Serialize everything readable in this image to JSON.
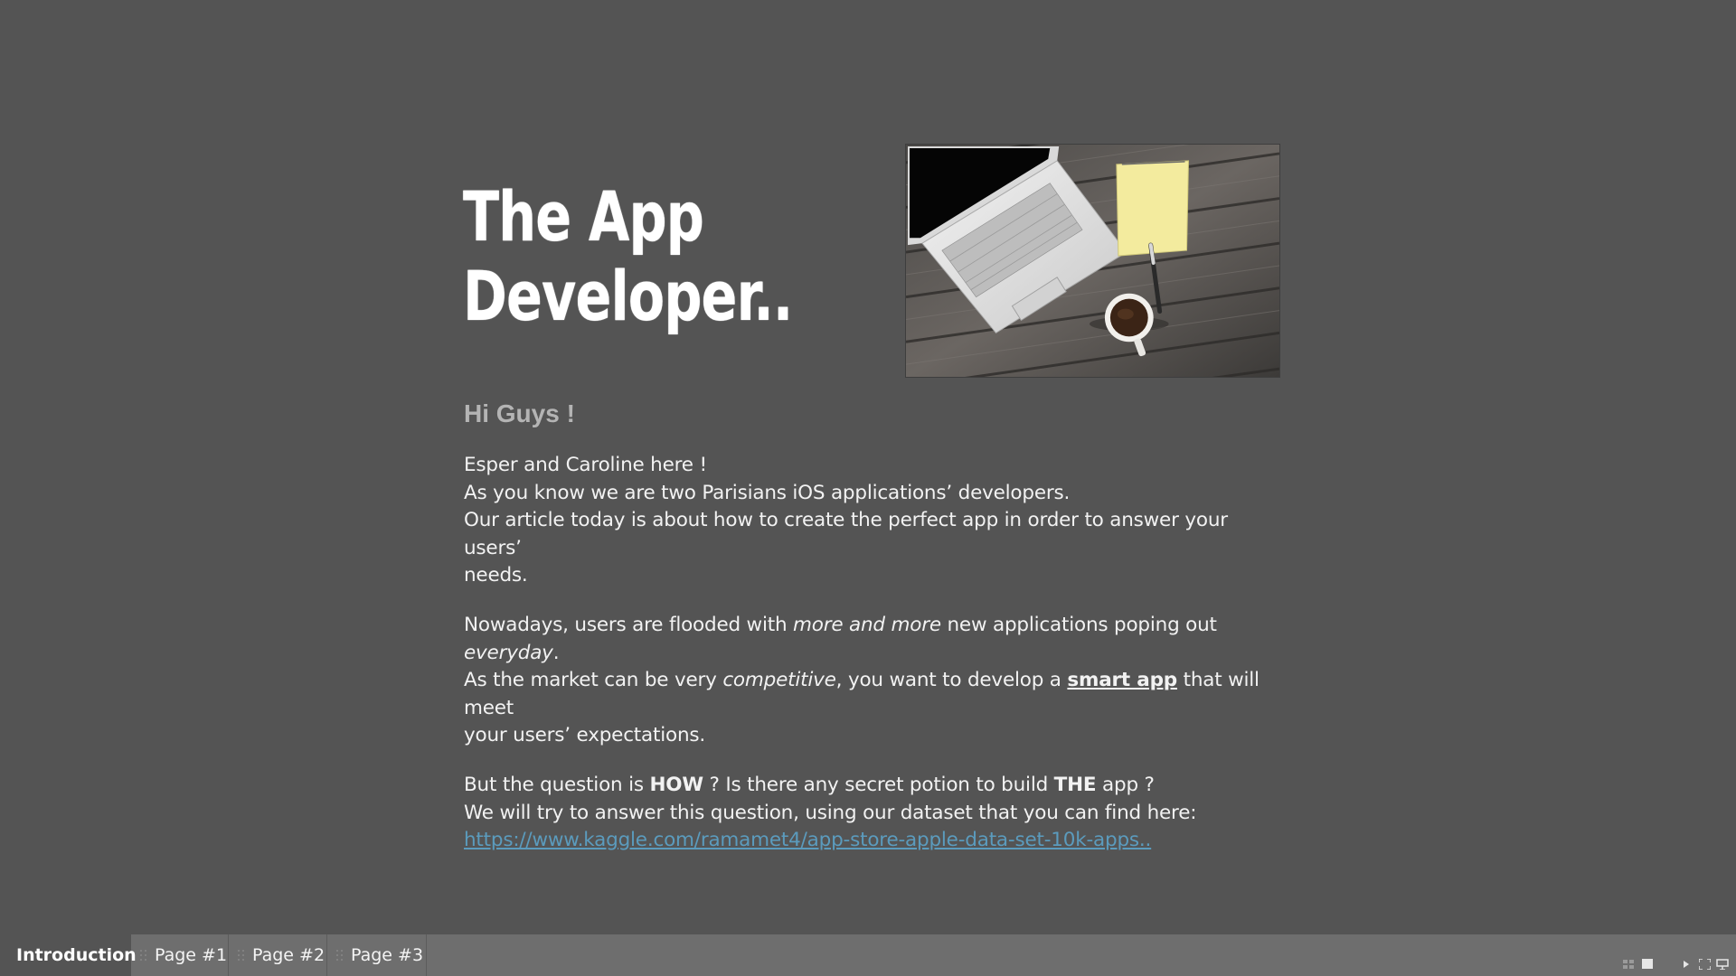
{
  "story": {
    "title_line1": "The App",
    "title_line2": "Developer..",
    "greeting": "Hi Guys !",
    "p1": {
      "line1": "Esper and Caroline here !",
      "line2": "As you know we are two Parisians iOS applications’ developers.",
      "line3a": "Our article today is about how to create the perfect app in order to answer your users’",
      "line3b": "needs."
    },
    "p2": {
      "a": "Nowadays, users are flooded with ",
      "a_em": "more and more",
      "a_rest": " new applications poping out",
      "b_em": "everyday",
      "b_rest": ".",
      "c": "As the market can be very ",
      "c_em": "competitive",
      "c_mid": ", you want to develop a ",
      "c_link": "smart app",
      "c_rest": " that will meet",
      "d": "your users’ expectations."
    },
    "p3": {
      "a": "But the question is ",
      "a_b1": "HOW",
      "a_mid": " ? Is there any secret potion to build ",
      "a_b2": "THE",
      "a_rest": " app ?",
      "b": "We will try to answer this question, using our dataset that you can find here:",
      "url": "https://www.kaggle.com/ramamet4/app-store-apple-data-set-10k-apps.."
    }
  },
  "tabs": [
    {
      "label": "Introduction",
      "active": true
    },
    {
      "label": "Page #1",
      "active": false
    },
    {
      "label": "Page #2",
      "active": false
    },
    {
      "label": "Page #3",
      "active": false
    }
  ],
  "controls": {
    "icons": [
      "grid-view-icon",
      "single-view-icon",
      "play-icon",
      "fullscreen-icon",
      "present-icon"
    ]
  },
  "colors": {
    "background": "#545454",
    "tabbar": "#6e6e6e",
    "link": "#5b9bbd",
    "greeting": "#b4b4b4"
  }
}
